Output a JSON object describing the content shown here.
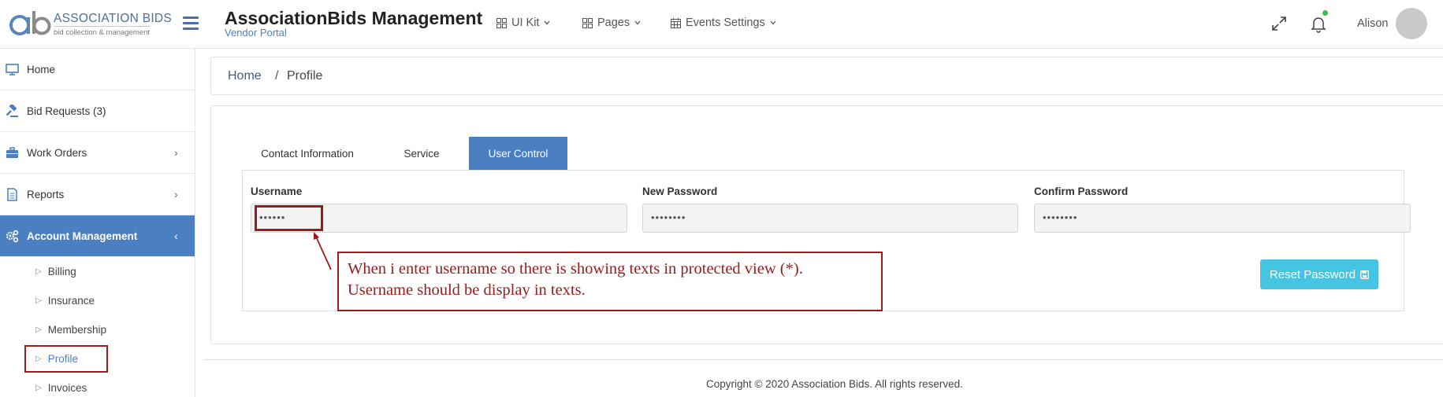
{
  "header": {
    "logo_line1": "ASSOCIATION BIDS",
    "logo_line2": "bid collection & management",
    "title": "AssociationBids Management",
    "subtitle": "Vendor Portal",
    "nav": [
      {
        "label": "UI Kit",
        "icon": "grid-icon"
      },
      {
        "label": "Pages",
        "icon": "grid-icon"
      },
      {
        "label": "Events Settings",
        "icon": "calendar-icon"
      }
    ],
    "user_name": "Alison",
    "notification_dot_color": "#3bbf4a"
  },
  "sidebar": {
    "items": [
      {
        "label": "Home",
        "icon": "monitor-icon"
      },
      {
        "label": "Bid Requests (3)",
        "icon": "gavel-icon"
      },
      {
        "label": "Work Orders",
        "icon": "briefcase-icon"
      },
      {
        "label": "Reports",
        "icon": "document-icon"
      },
      {
        "label": "Account Management",
        "icon": "gears-icon"
      }
    ],
    "sub_items": [
      "Billing",
      "Insurance",
      "Membership",
      "Profile",
      "Invoices"
    ],
    "active_color": "#4a7fc1"
  },
  "breadcrumb": {
    "home": "Home",
    "separator": "/",
    "current": "Profile"
  },
  "tabs": [
    "Contact Information",
    "Service",
    "User Control"
  ],
  "form": {
    "username_label": "Username",
    "username_value": "••••••",
    "new_password_label": "New Password",
    "new_password_value": "••••••••",
    "confirm_password_label": "Confirm Password",
    "confirm_password_value": "••••••••",
    "reset_button": "Reset Password"
  },
  "annotation": {
    "line1": "When i enter username so there is showing texts in protected view (*).",
    "line2": "Username should be display in texts.",
    "color": "#9c1a1a"
  },
  "footer": "Copyright © 2020 Association Bids. All rights reserved."
}
